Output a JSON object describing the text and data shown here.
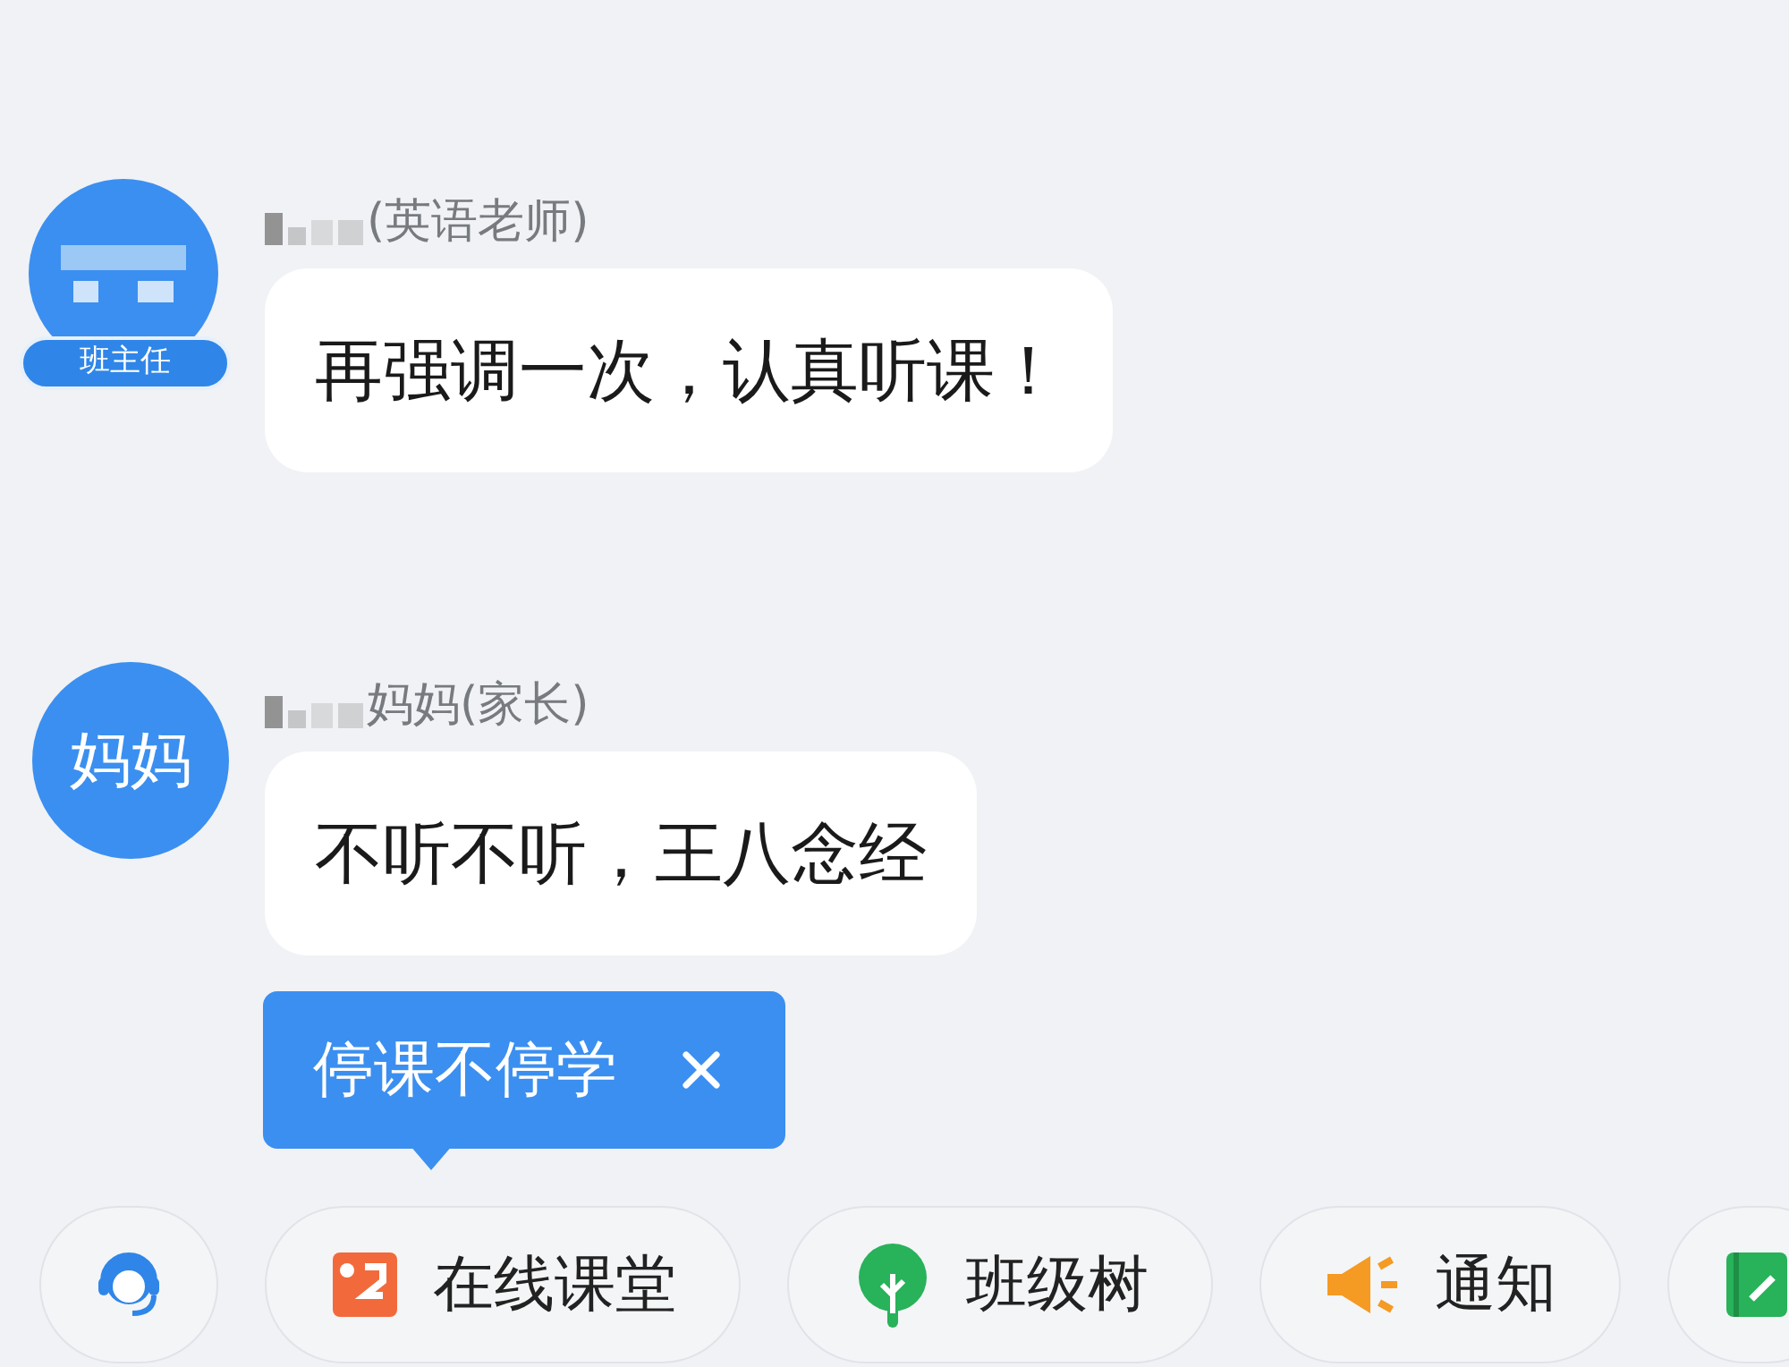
{
  "messages": [
    {
      "sender": "(英语老师)",
      "avatar": {
        "kind": "pixelated",
        "badge": "班主任"
      },
      "text": "再强调一次，认真听课！"
    },
    {
      "sender": "妈妈(家长)",
      "avatar": {
        "kind": "text",
        "label": "妈妈"
      },
      "text": "不听不听，王八念经"
    }
  ],
  "tip": {
    "text": "停课不停学"
  },
  "toolbar": [
    {
      "kind": "support"
    },
    {
      "kind": "classroom",
      "label": "在线课堂"
    },
    {
      "kind": "tree",
      "label": "班级树"
    },
    {
      "kind": "notice",
      "label": "通知"
    },
    {
      "kind": "homework"
    }
  ]
}
